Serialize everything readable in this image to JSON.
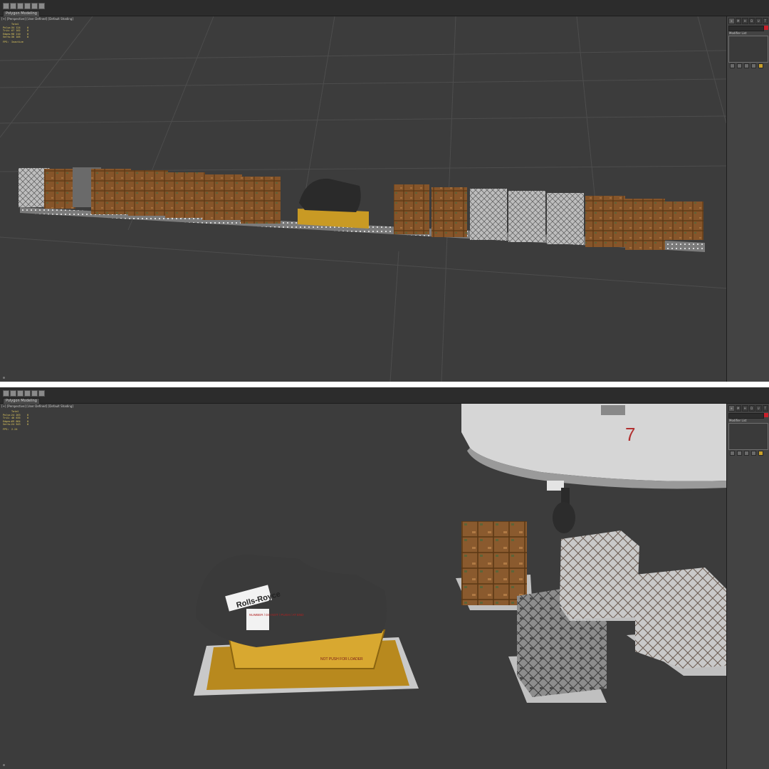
{
  "panels": [
    {
      "mode_dropdown": "Polygon Modeling",
      "viewport_label": "[+] [Perspective] [User Defined] [Default Shading]",
      "stats": {
        "header": "Total",
        "rows": [
          {
            "k": "Polys:",
            "v": "34 124",
            "c": "0"
          },
          {
            "k": "Tris:",
            "v": "67 102",
            "c": "0"
          },
          {
            "k": "Edges:",
            "v": "98 210",
            "c": "0"
          },
          {
            "k": "Verts:",
            "v": "36 105",
            "c": "0"
          }
        ],
        "fps_label": "FPS:",
        "fps_value": "Inactive"
      },
      "command_panel": {
        "tabs": [
          "+",
          "M",
          "H",
          "D",
          "U",
          "T"
        ],
        "modifier_list_label": "Modifier List",
        "swatch_color": "#c8202a"
      }
    },
    {
      "mode_dropdown": "Polygon Modeling",
      "viewport_label": "[+] [Perspective] [User Defined] [Default Shading]",
      "stats": {
        "header": "Total",
        "rows": [
          {
            "k": "Polys:",
            "v": "24 263",
            "c": "0"
          },
          {
            "k": "Tris:",
            "v": "46 635",
            "c": "0"
          },
          {
            "k": "Edges:",
            "v": "69 664",
            "c": "0"
          },
          {
            "k": "Verts:",
            "v": "24 543",
            "c": "0"
          }
        ],
        "fps_label": "FPS:",
        "fps_value": "2.24"
      },
      "command_panel": {
        "tabs": [
          "+",
          "M",
          "H",
          "D",
          "U",
          "T"
        ],
        "modifier_list_label": "Modifier List",
        "swatch_color": "#c8202a"
      }
    }
  ],
  "scene_bottom": {
    "engine_brand": "Rolls-Royce",
    "engine_warning": "NUMBER / DO NOT / PUSH / AT END",
    "engine_base_text": "NOT PUSH FOR LOADER",
    "fuselage_number": "7"
  },
  "colors": {
    "viewport_bg": "#3c3c3c",
    "grid": "#4f4f4f",
    "stats_text": "#e8d060",
    "crate_brown": "#8a5a2e",
    "crate_net": "#c9c9c9",
    "engine_base": "#c99a24"
  }
}
